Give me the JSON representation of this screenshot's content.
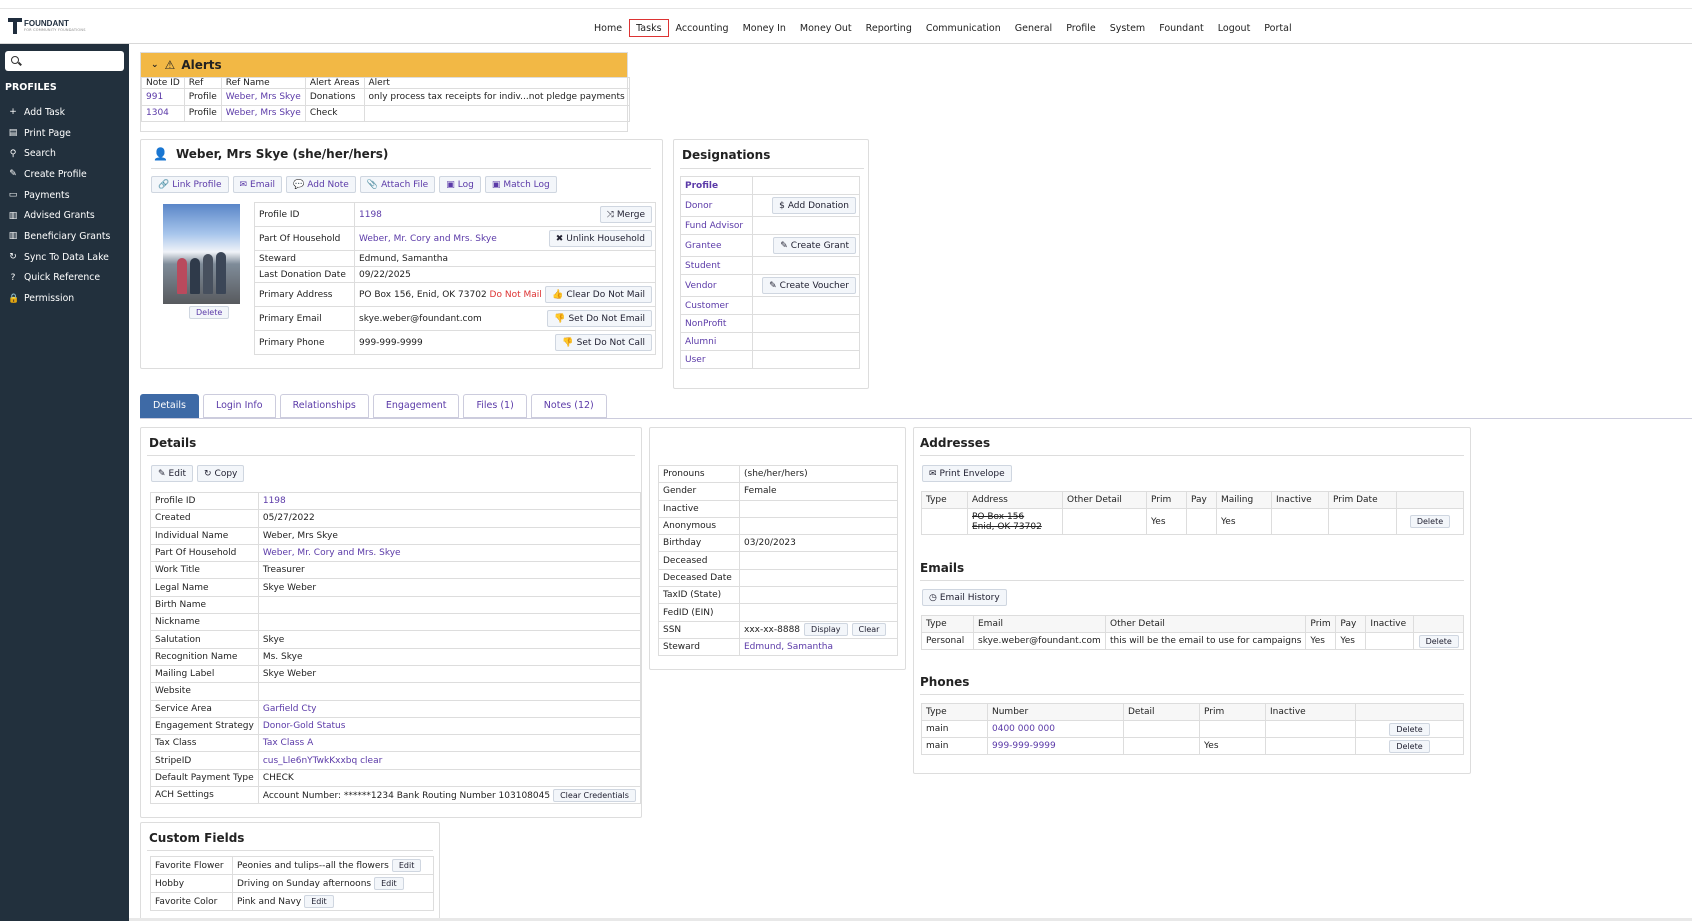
{
  "brand": {
    "name": "FOUNDANT",
    "tagline": "FOR COMMUNITY FOUNDATIONS"
  },
  "topnav": [
    "Home",
    "Tasks",
    "Accounting",
    "Money In",
    "Money Out",
    "Reporting",
    "Communication",
    "General",
    "Profile",
    "System",
    "Foundant",
    "Logout",
    "Portal"
  ],
  "topnav_active": "Tasks",
  "sidebar": {
    "search_placeholder": "",
    "heading": "PROFILES",
    "items": [
      {
        "label": "Add Task",
        "icon": "+"
      },
      {
        "label": "Print Page",
        "icon": "▤"
      },
      {
        "label": "Search",
        "icon": "⚲"
      },
      {
        "label": "Create Profile",
        "icon": "✎"
      },
      {
        "label": "Payments",
        "icon": "▭"
      },
      {
        "label": "Advised Grants",
        "icon": "▥"
      },
      {
        "label": "Beneficiary Grants",
        "icon": "▥"
      },
      {
        "label": "Sync To Data Lake",
        "icon": "↻"
      },
      {
        "label": "Quick Reference",
        "icon": "?"
      },
      {
        "label": "Permission",
        "icon": "🔒"
      }
    ]
  },
  "alerts": {
    "title": "Alerts",
    "headers": [
      "Note ID",
      "Ref",
      "Ref Name",
      "Alert Areas",
      "Alert"
    ],
    "rows": [
      [
        "991",
        "Profile",
        "Weber, Mrs Skye",
        "Donations",
        "only process tax receipts for indiv...not pledge payments"
      ],
      [
        "1304",
        "Profile",
        "Weber, Mrs Skye",
        "Check",
        ""
      ]
    ]
  },
  "profile": {
    "name": "Weber, Mrs Skye (she/her/hers)",
    "actions": [
      "Link Profile",
      "Email",
      "Add Note",
      "Attach File",
      "Log",
      "Match Log"
    ],
    "photo_delete": "Delete",
    "fields": [
      {
        "label": "Profile ID",
        "value": "1198",
        "link": true,
        "button": "Merge",
        "btn_icon": "⤨"
      },
      {
        "label": "Part Of Household",
        "value": "Weber, Mr. Cory and Mrs. Skye",
        "link": true,
        "button": "Unlink Household",
        "btn_icon": "✖"
      },
      {
        "label": "Steward",
        "value": "Edmund, Samantha",
        "link": false,
        "button": "",
        "btn_icon": ""
      },
      {
        "label": "Last Donation Date",
        "value": "09/22/2025",
        "link": false,
        "button": "",
        "btn_icon": ""
      },
      {
        "label": "Primary Address",
        "value": "PO Box 156, Enid, OK 73702",
        "extra": "Do Not Mail",
        "link": false,
        "button": "Clear Do Not Mail",
        "btn_icon": "👍"
      },
      {
        "label": "Primary Email",
        "value": "skye.weber@foundant.com",
        "link": false,
        "button": "Set Do Not Email",
        "btn_icon": "👎"
      },
      {
        "label": "Primary Phone",
        "value": "999-999-9999",
        "link": false,
        "button": "Set Do Not Call",
        "btn_icon": "👎"
      }
    ]
  },
  "designations": {
    "title": "Designations",
    "rows": [
      {
        "label": "Profile",
        "bold": true,
        "button": ""
      },
      {
        "label": "Donor",
        "button": "Add Donation",
        "btn_icon": "$"
      },
      {
        "label": "Fund Advisor",
        "button": ""
      },
      {
        "label": "Grantee",
        "button": "Create Grant",
        "btn_icon": "✎"
      },
      {
        "label": "Student",
        "button": ""
      },
      {
        "label": "Vendor",
        "button": "Create Voucher",
        "btn_icon": "✎"
      },
      {
        "label": "Customer",
        "button": ""
      },
      {
        "label": "NonProfit",
        "button": ""
      },
      {
        "label": "Alumni",
        "button": ""
      },
      {
        "label": "User",
        "button": ""
      }
    ]
  },
  "tabs": [
    "Details",
    "Login Info",
    "Relationships",
    "Engagement",
    "Files (1)",
    "Notes (12)"
  ],
  "tab_active": "Details",
  "details": {
    "title": "Details",
    "edit": "Edit",
    "copy": "Copy",
    "rows": [
      {
        "label": "Profile ID",
        "value": "1198",
        "link": true
      },
      {
        "label": "Created",
        "value": "05/27/2022"
      },
      {
        "label": "Individual Name",
        "value": "Weber, Mrs Skye"
      },
      {
        "label": "Part Of Household",
        "value": "Weber, Mr. Cory and Mrs. Skye",
        "link": true
      },
      {
        "label": "Work Title",
        "value": "Treasurer"
      },
      {
        "label": "Legal Name",
        "value": "Skye Weber"
      },
      {
        "label": "Birth Name",
        "value": ""
      },
      {
        "label": "Nickname",
        "value": ""
      },
      {
        "label": "Salutation",
        "value": "Skye"
      },
      {
        "label": "Recognition Name",
        "value": "Ms. Skye"
      },
      {
        "label": "Mailing Label",
        "value": "Skye Weber"
      },
      {
        "label": "Website",
        "value": ""
      },
      {
        "label": "Service Area",
        "value": "Garfield Cty",
        "link": true
      },
      {
        "label": "Engagement Strategy",
        "value": "Donor-Gold Status",
        "link": true
      },
      {
        "label": "Tax Class",
        "value": "Tax Class A",
        "link": true
      },
      {
        "label": "StripeID",
        "value": "cus_Lle6nYTwkKxxbq clear",
        "link": true
      },
      {
        "label": "Default Payment Type",
        "value": "CHECK"
      },
      {
        "label": "ACH Settings",
        "value": "Account Number: ******1234 Bank Routing Number 103108045",
        "button": "Clear Credentials"
      }
    ]
  },
  "personal": {
    "rows": [
      {
        "label": "Pronouns",
        "value": "(she/her/hers)"
      },
      {
        "label": "Gender",
        "value": "Female"
      },
      {
        "label": "Inactive",
        "value": ""
      },
      {
        "label": "Anonymous",
        "value": ""
      },
      {
        "label": "Birthday",
        "value": "03/20/2023"
      },
      {
        "label": "Deceased",
        "value": ""
      },
      {
        "label": "Deceased Date",
        "value": ""
      },
      {
        "label": "TaxID (State)",
        "value": ""
      },
      {
        "label": "FedID (EIN)",
        "value": ""
      },
      {
        "label": "SSN",
        "value": "xxx-xx-8888",
        "buttons": [
          "Display",
          "Clear"
        ]
      },
      {
        "label": "Steward",
        "value": "Edmund, Samantha",
        "link": true
      }
    ]
  },
  "addresses": {
    "title": "Addresses",
    "print": "Print Envelope",
    "headers": [
      "Type",
      "Address",
      "Other Detail",
      "Prim",
      "Pay",
      "Mailing",
      "Inactive",
      "Prim Date",
      ""
    ],
    "rows": [
      [
        "",
        "PO Box 156|Enid, OK 73702",
        "",
        "Yes",
        "",
        "Yes",
        "",
        "",
        "Delete"
      ]
    ]
  },
  "emails": {
    "title": "Emails",
    "history": "Email History",
    "headers": [
      "Type",
      "Email",
      "Other Detail",
      "Prim",
      "Pay",
      "Inactive",
      ""
    ],
    "rows": [
      [
        "Personal",
        "skye.weber@foundant.com",
        "this will be the email to use for campaigns",
        "Yes",
        "Yes",
        "",
        "Delete"
      ]
    ]
  },
  "phones": {
    "title": "Phones",
    "headers": [
      "Type",
      "Number",
      "Detail",
      "Prim",
      "Inactive",
      ""
    ],
    "rows": [
      [
        "main",
        "0400 000 000",
        "",
        "",
        "",
        "Delete"
      ],
      [
        "main",
        "999-999-9999",
        "",
        "Yes",
        "",
        "Delete"
      ]
    ]
  },
  "custom_fields": {
    "title": "Custom Fields",
    "rows": [
      {
        "label": "Favorite Flower",
        "value": "Peonies and tulips--all the flowers",
        "button": "Edit"
      },
      {
        "label": "Hobby",
        "value": "Driving on Sunday afternoons",
        "button": "Edit"
      },
      {
        "label": "Favorite Color",
        "value": "Pink and Navy",
        "button": "Edit"
      }
    ]
  }
}
